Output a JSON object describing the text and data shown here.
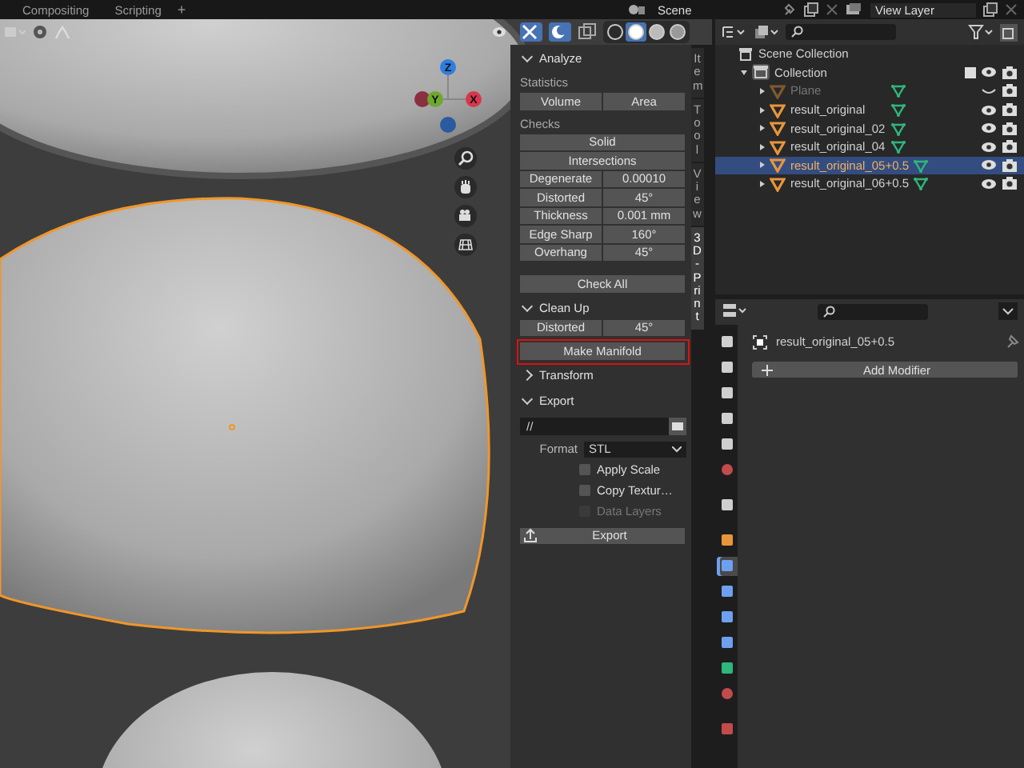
{
  "top_bar": {
    "workspace_tabs": [
      {
        "label": "Compositing",
        "selected": false
      },
      {
        "label": "Scripting",
        "selected": false
      }
    ],
    "add_tab": "+",
    "scene": "Scene",
    "view_layer": "View Layer"
  },
  "viewport": {
    "shading_modes": [
      {
        "kind": "wireframe",
        "selected": false
      },
      {
        "kind": "solid",
        "selected": true
      },
      {
        "kind": "material",
        "selected": false
      },
      {
        "kind": "rendered",
        "selected": false
      }
    ],
    "gizmo_axes": [
      "Z",
      "Y",
      "X"
    ]
  },
  "sidebar": {
    "tabs": [
      {
        "label": "Item",
        "selected": false
      },
      {
        "label": "Tool",
        "selected": false
      },
      {
        "label": "View",
        "selected": false
      },
      {
        "label": "3D-Print",
        "selected": true
      }
    ],
    "analyze": {
      "title": "Analyze",
      "expanded": true,
      "statistics_label": "Statistics",
      "statistics_buttons": [
        "Volume",
        "Area"
      ],
      "checks_label": "Checks",
      "check_buttons": [
        "Solid",
        "Intersections"
      ],
      "check_rows": [
        {
          "label": "Degenerate",
          "value": "0.00010"
        },
        {
          "label": "Distorted",
          "value": "45°"
        },
        {
          "label": "Thickness",
          "value": "0.001 mm"
        },
        {
          "label": "Edge Sharp",
          "value": "160°"
        },
        {
          "label": "Overhang",
          "value": "45°"
        }
      ],
      "check_all": "Check All"
    },
    "clean_up": {
      "title": "Clean Up",
      "expanded": true,
      "distorted": {
        "label": "Distorted",
        "value": "45°"
      },
      "make_manifold": {
        "label": "Make Manifold",
        "highlighted": true
      }
    },
    "transform": {
      "title": "Transform",
      "expanded": false
    },
    "export": {
      "title": "Export",
      "expanded": true,
      "path": "//",
      "format_label": "Format",
      "format": "STL",
      "options": [
        {
          "label": "Apply Scale",
          "checked": false,
          "disabled": false
        },
        {
          "label": "Copy Textur…",
          "checked": false,
          "disabled": false
        },
        {
          "label": "Data Layers",
          "checked": false,
          "disabled": true
        }
      ],
      "export_button": "Export"
    }
  },
  "outliner": {
    "root": "Scene Collection",
    "collection": {
      "name": "Collection",
      "expanded": true,
      "checked": true,
      "children": [
        {
          "name": "Plane",
          "selected": false,
          "visible": false
        },
        {
          "name": "result_original",
          "selected": false,
          "visible": true
        },
        {
          "name": "result_original_02",
          "selected": false,
          "visible": true
        },
        {
          "name": "result_original_04",
          "selected": false,
          "visible": true
        },
        {
          "name": "result_original_05+0.5",
          "selected": true,
          "visible": true
        },
        {
          "name": "result_original_06+0.5",
          "selected": false,
          "visible": true
        }
      ]
    }
  },
  "properties": {
    "object_name": "result_original_05+0.5",
    "add_modifier": "Add Modifier",
    "tabs": [
      {
        "kind": "tool",
        "selected": false
      },
      {
        "kind": "render",
        "selected": false
      },
      {
        "kind": "output",
        "selected": false
      },
      {
        "kind": "view_layer",
        "selected": false
      },
      {
        "kind": "scene",
        "selected": false
      },
      {
        "kind": "world",
        "selected": false
      },
      {
        "kind": "collection",
        "selected": false
      },
      {
        "kind": "object",
        "selected": false
      },
      {
        "kind": "modifiers",
        "selected": true
      },
      {
        "kind": "particles",
        "selected": false
      },
      {
        "kind": "physics",
        "selected": false
      },
      {
        "kind": "constraints",
        "selected": false
      },
      {
        "kind": "data",
        "selected": false
      },
      {
        "kind": "material",
        "selected": false
      },
      {
        "kind": "texture",
        "selected": false
      }
    ]
  }
}
